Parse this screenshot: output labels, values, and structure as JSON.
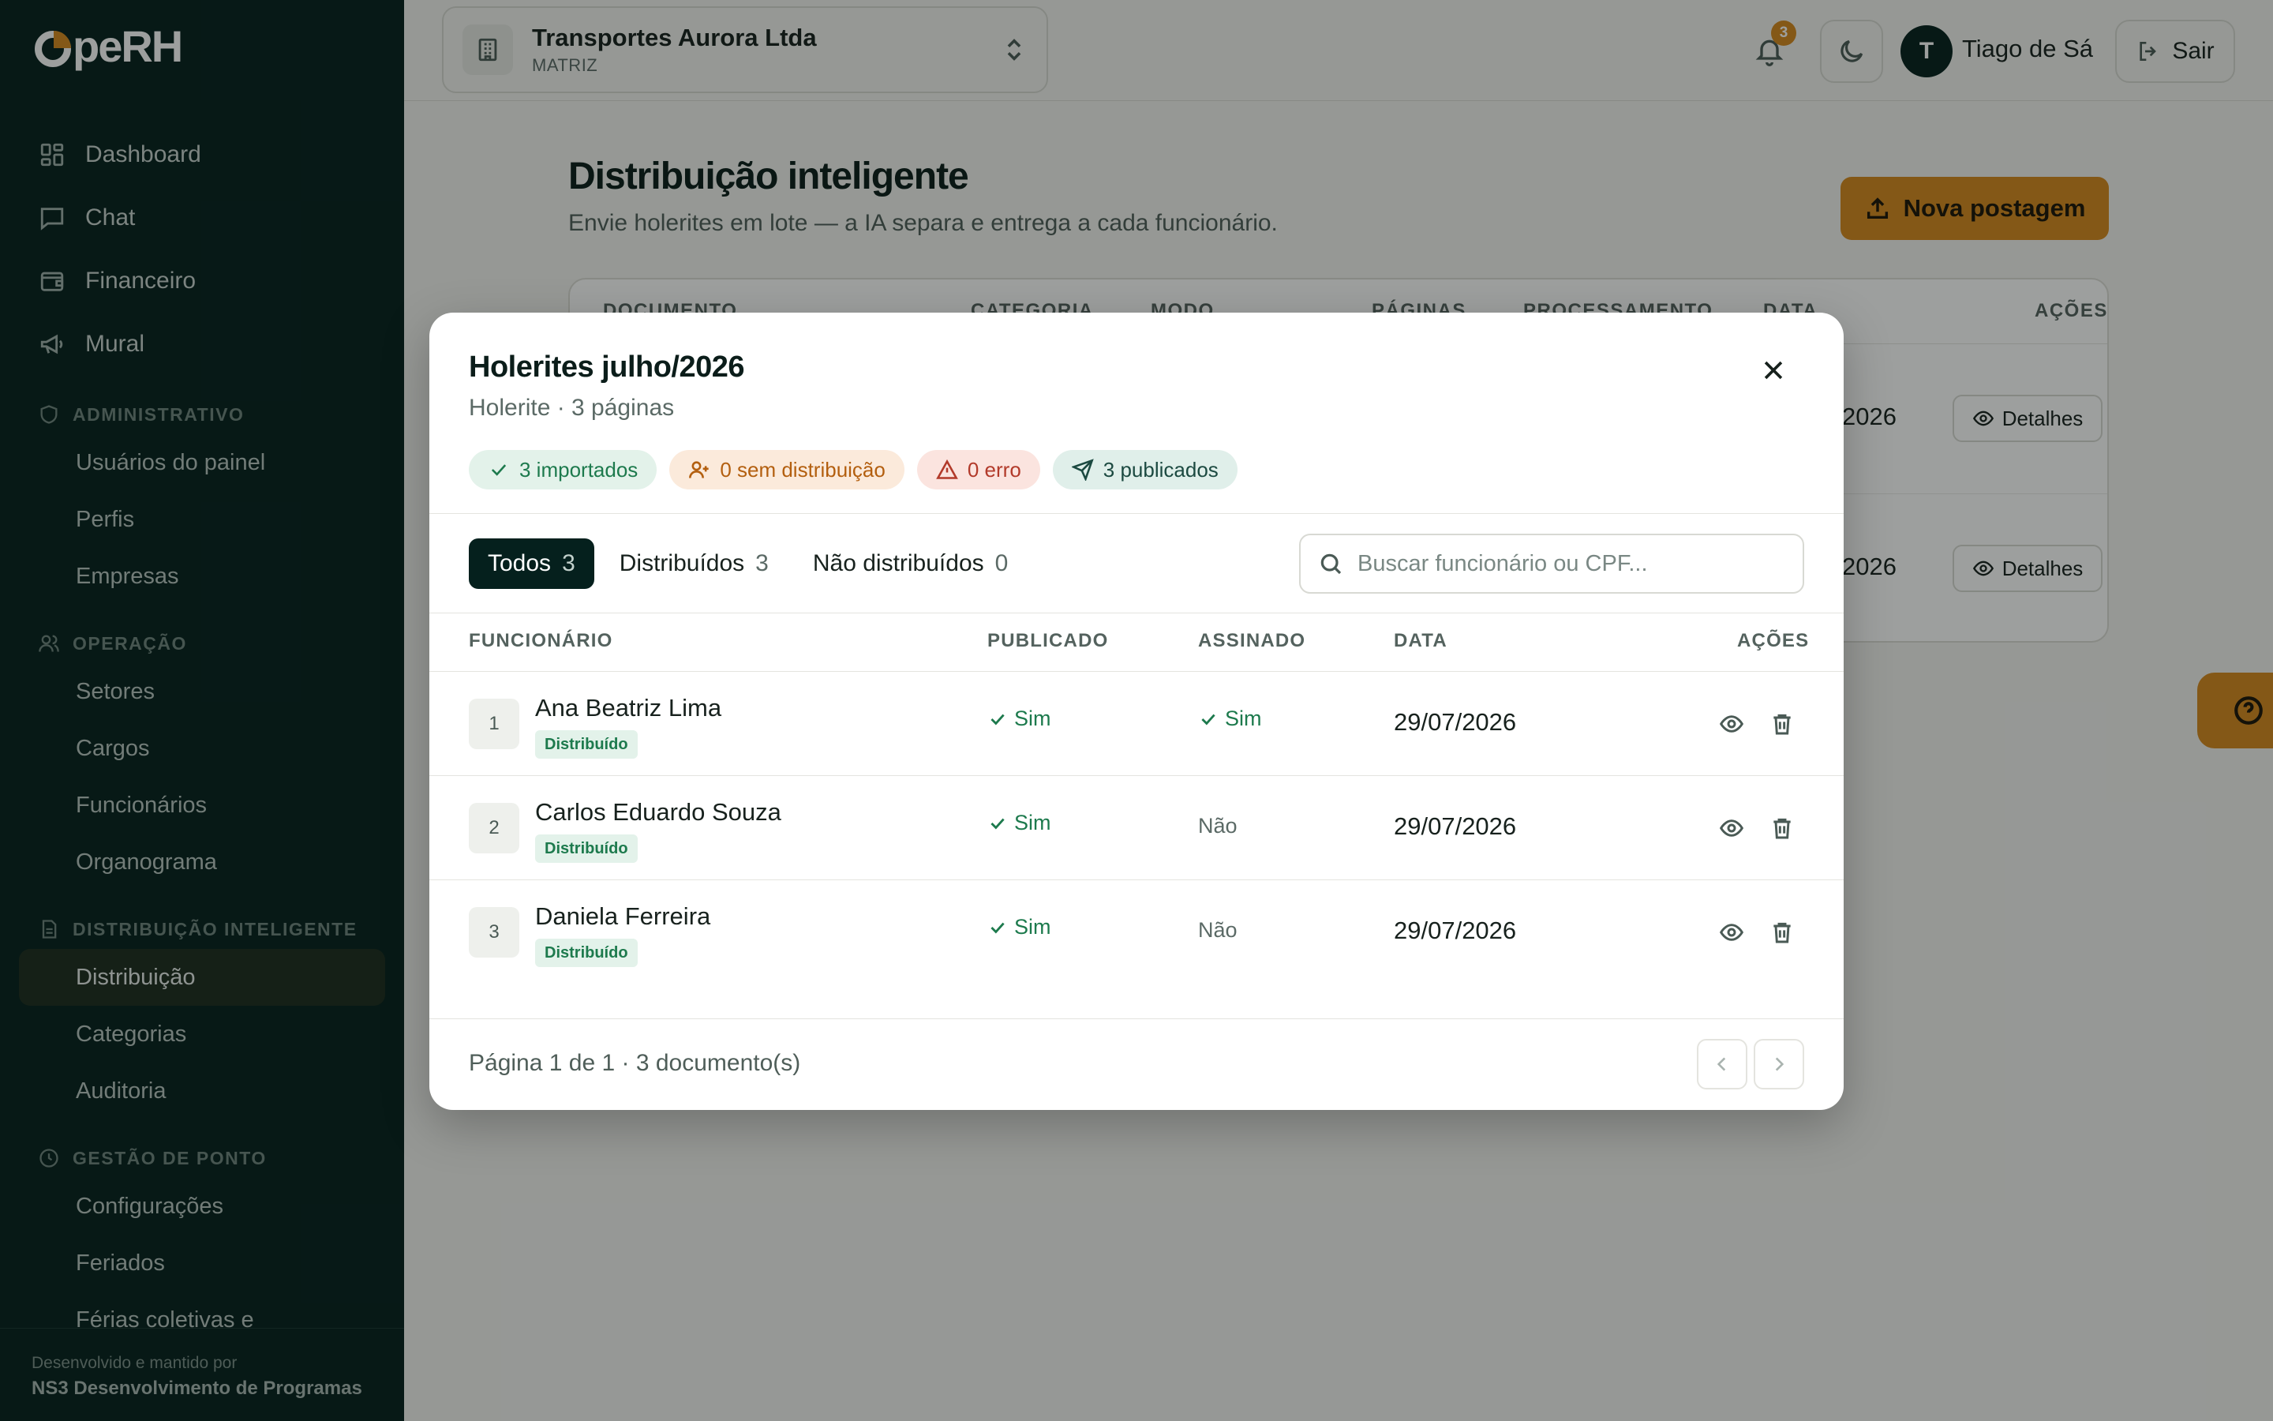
{
  "app": {
    "logo": "OpeRH"
  },
  "sidebar": {
    "main_items": [
      {
        "label": "Dashboard",
        "icon": "dashboard-icon"
      },
      {
        "label": "Chat",
        "icon": "chat-icon"
      },
      {
        "label": "Financeiro",
        "icon": "wallet-icon"
      },
      {
        "label": "Mural",
        "icon": "megaphone-icon"
      }
    ],
    "sections": [
      {
        "title": "ADMINISTRATIVO",
        "icon": "shield-icon",
        "items": [
          "Usuários do painel",
          "Perfis",
          "Empresas"
        ]
      },
      {
        "title": "OPERAÇÃO",
        "icon": "users-icon",
        "items": [
          "Setores",
          "Cargos",
          "Funcionários",
          "Organograma"
        ]
      },
      {
        "title": "DISTRIBUIÇÃO INTELIGENTE",
        "icon": "file-icon",
        "items": [
          "Distribuição",
          "Categorias",
          "Auditoria"
        ]
      },
      {
        "title": "GESTÃO DE PONTO",
        "icon": "clock-icon",
        "items": [
          "Configurações",
          "Feriados",
          "Férias coletivas e"
        ]
      }
    ],
    "active_item": "Distribuição",
    "footer": {
      "line1": "Desenvolvido e mantido por",
      "line2": "NS3 Desenvolvimento de Programas"
    }
  },
  "topbar": {
    "company_name": "Transportes Aurora Ltda",
    "company_type": "MATRIZ",
    "notification_count": "3",
    "user_initial": "T",
    "user_name": "Tiago de Sá",
    "logout_label": "Sair"
  },
  "page": {
    "title": "Distribuição inteligente",
    "subtitle": "Envie holerites em lote — a IA separa e entrega a cada funcionário.",
    "new_post_label": "Nova postagem",
    "table_headers": [
      "DOCUMENTO",
      "CATEGORIA",
      "MODO",
      "PÁGINAS",
      "PROCESSAMENTO",
      "DATA",
      "AÇÕES"
    ],
    "rows": [
      {
        "date_fragment": "2026",
        "details_label": "Detalhes"
      },
      {
        "date_fragment": "2026",
        "details_label": "Detalhes"
      }
    ]
  },
  "modal": {
    "title": "Holerites julho/2026",
    "subtitle": "Holerite · 3 páginas",
    "chips": [
      {
        "label": "3 importados",
        "tone": "green",
        "icon": "check-icon"
      },
      {
        "label": "0 sem distribuição",
        "tone": "orange",
        "icon": "user-plus-icon"
      },
      {
        "label": "0 erro",
        "tone": "red",
        "icon": "alert-triangle-icon"
      },
      {
        "label": "3 publicados",
        "tone": "teal",
        "icon": "send-icon"
      }
    ],
    "tabs": [
      {
        "label": "Todos",
        "count": "3",
        "active": true
      },
      {
        "label": "Distribuídos",
        "count": "3",
        "active": false
      },
      {
        "label": "Não distribuídos",
        "count": "0",
        "active": false
      }
    ],
    "search_placeholder": "Buscar funcionário ou CPF...",
    "columns": [
      "FUNCIONÁRIO",
      "PUBLICADO",
      "ASSINADO",
      "DATA",
      "AÇÕES"
    ],
    "rows": [
      {
        "index": "1",
        "name": "Ana Beatriz Lima",
        "status": "Distribuído",
        "published": "Sim",
        "signed": "Sim",
        "signed_yes": true,
        "date": "29/07/2026"
      },
      {
        "index": "2",
        "name": "Carlos Eduardo Souza",
        "status": "Distribuído",
        "published": "Sim",
        "signed": "Não",
        "signed_yes": false,
        "date": "29/07/2026"
      },
      {
        "index": "3",
        "name": "Daniela Ferreira",
        "status": "Distribuído",
        "published": "Sim",
        "signed": "Não",
        "signed_yes": false,
        "date": "29/07/2026"
      }
    ],
    "pagination_text": "Página 1 de 1 · 3 documento(s)"
  },
  "colors": {
    "sidebar_bg": "#05201d",
    "accent": "#d6891f",
    "success": "#1d7a4d"
  }
}
